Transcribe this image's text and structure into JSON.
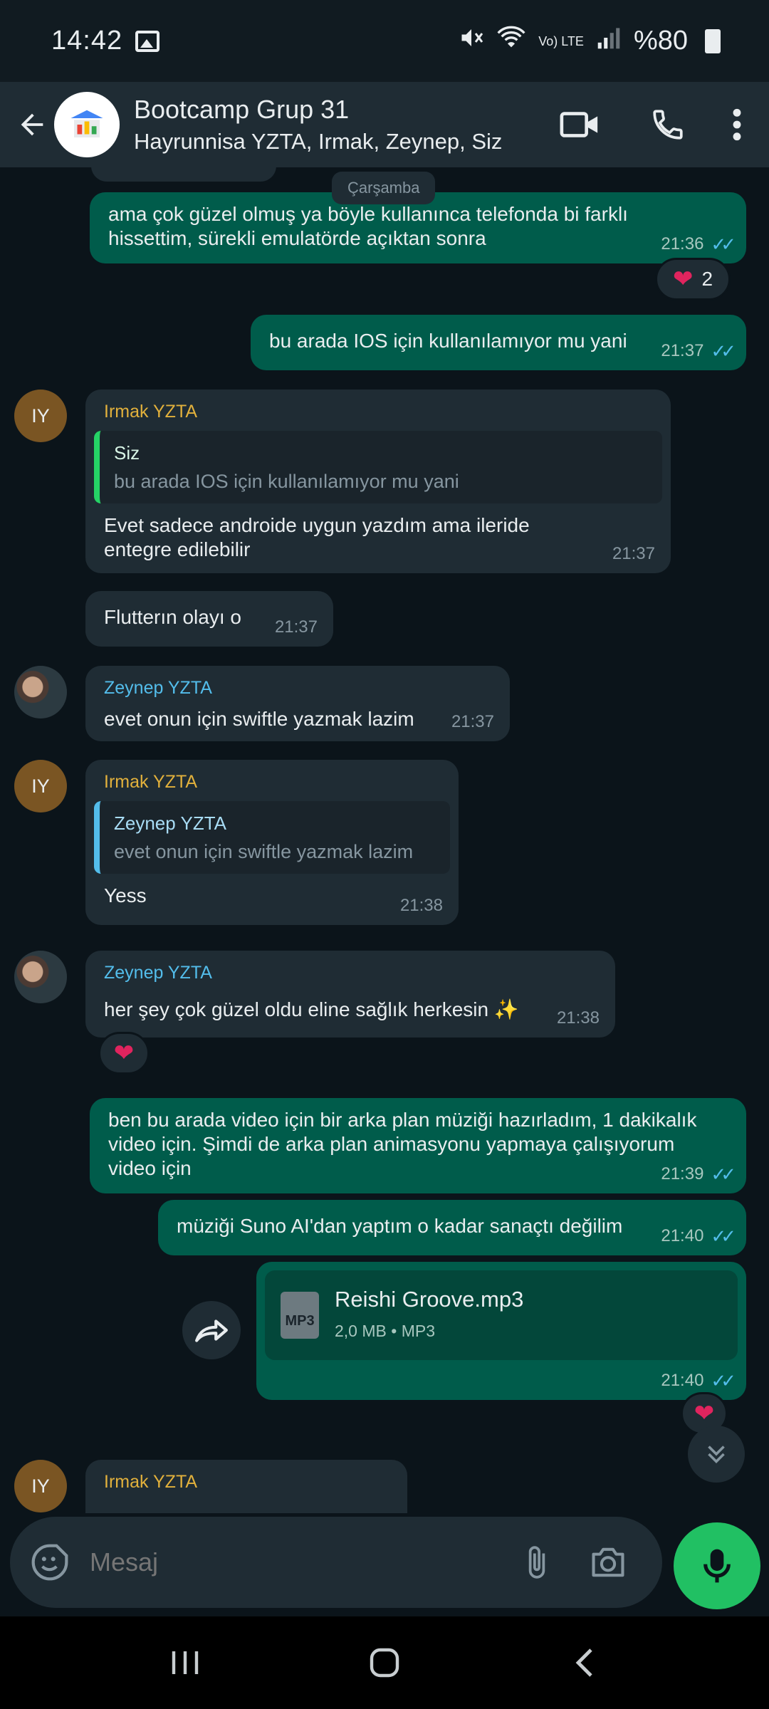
{
  "status_bar": {
    "time": "14:42",
    "battery": "%80",
    "network": "Vo) LTE"
  },
  "header": {
    "title": "Bootcamp Grup 31",
    "subtitle": "Hayrunnisa YZTA, Irmak, Zeynep, Siz"
  },
  "date_chip": "Çarşamba",
  "messages": [
    {
      "id": "m1",
      "text": "ama çok güzel olmuş ya böyle kullanınca telefonda bi farklı hissettim, sürekli emulatörde açıktan sonra",
      "time": "21:36",
      "reaction_count": "2"
    },
    {
      "id": "m2",
      "text": "bu arada IOS için kullanılamıyor mu yani",
      "time": "21:37"
    },
    {
      "id": "m3",
      "sender": "Irmak YZTA",
      "quote_name": "Siz",
      "quote_text": "bu arada IOS için kullanılamıyor mu yani",
      "text": "Evet sadece androide uygun yazdım ama ileride entegre edilebilir",
      "time": "21:37",
      "avatar": "IY"
    },
    {
      "id": "m4",
      "text": "Flutterın olayı o",
      "time": "21:37"
    },
    {
      "id": "m5",
      "sender": "Zeynep YZTA",
      "text": "evet onun için swiftle yazmak lazim",
      "time": "21:37"
    },
    {
      "id": "m6",
      "sender": "Irmak YZTA",
      "quote_name": "Zeynep YZTA",
      "quote_text": "evet onun için swiftle yazmak lazim",
      "text": "Yess",
      "time": "21:38",
      "avatar": "IY"
    },
    {
      "id": "m7",
      "sender": "Zeynep YZTA",
      "text": "her şey çok güzel oldu eline sağlık herkesin ✨",
      "time": "21:38"
    },
    {
      "id": "m8",
      "text": "ben bu arada video için bir arka plan müziği hazırladım, 1 dakikalık video için. Şimdi de arka plan animasyonu yapmaya çalışıyorum video için",
      "time": "21:39"
    },
    {
      "id": "m9",
      "text": "müziği Suno AI'dan yaptım o kadar sanaçtı değilim",
      "time": "21:40"
    },
    {
      "id": "m10",
      "file_name": "Reishi Groove.mp3",
      "file_info": "2,0 MB • MP3",
      "file_type": "MP3",
      "time": "21:40"
    },
    {
      "id": "m11",
      "sender": "Irmak YZTA",
      "avatar": "IY"
    }
  ],
  "input": {
    "placeholder": "Mesaj"
  },
  "colors": {
    "background": "#0b141a",
    "header": "#1f2c34",
    "outgoing_bubble": "#005c4b",
    "incoming_bubble": "#1f2c34",
    "accent_green": "#21c063",
    "read_ticks": "#53bdeb",
    "irmak_name": "#e2b13c",
    "zeynep_name": "#53bdeb"
  },
  "icons": [
    "gallery-icon",
    "mute-icon",
    "wifi-icon",
    "signal-icon",
    "battery-icon",
    "back-arrow-icon",
    "video-call-icon",
    "phone-icon",
    "more-vert-icon",
    "heart-icon",
    "forward-icon",
    "double-chevron-down-icon",
    "sticker-icon",
    "attach-icon",
    "camera-icon",
    "mic-icon",
    "recents-icon",
    "home-icon",
    "nav-back-icon"
  ]
}
